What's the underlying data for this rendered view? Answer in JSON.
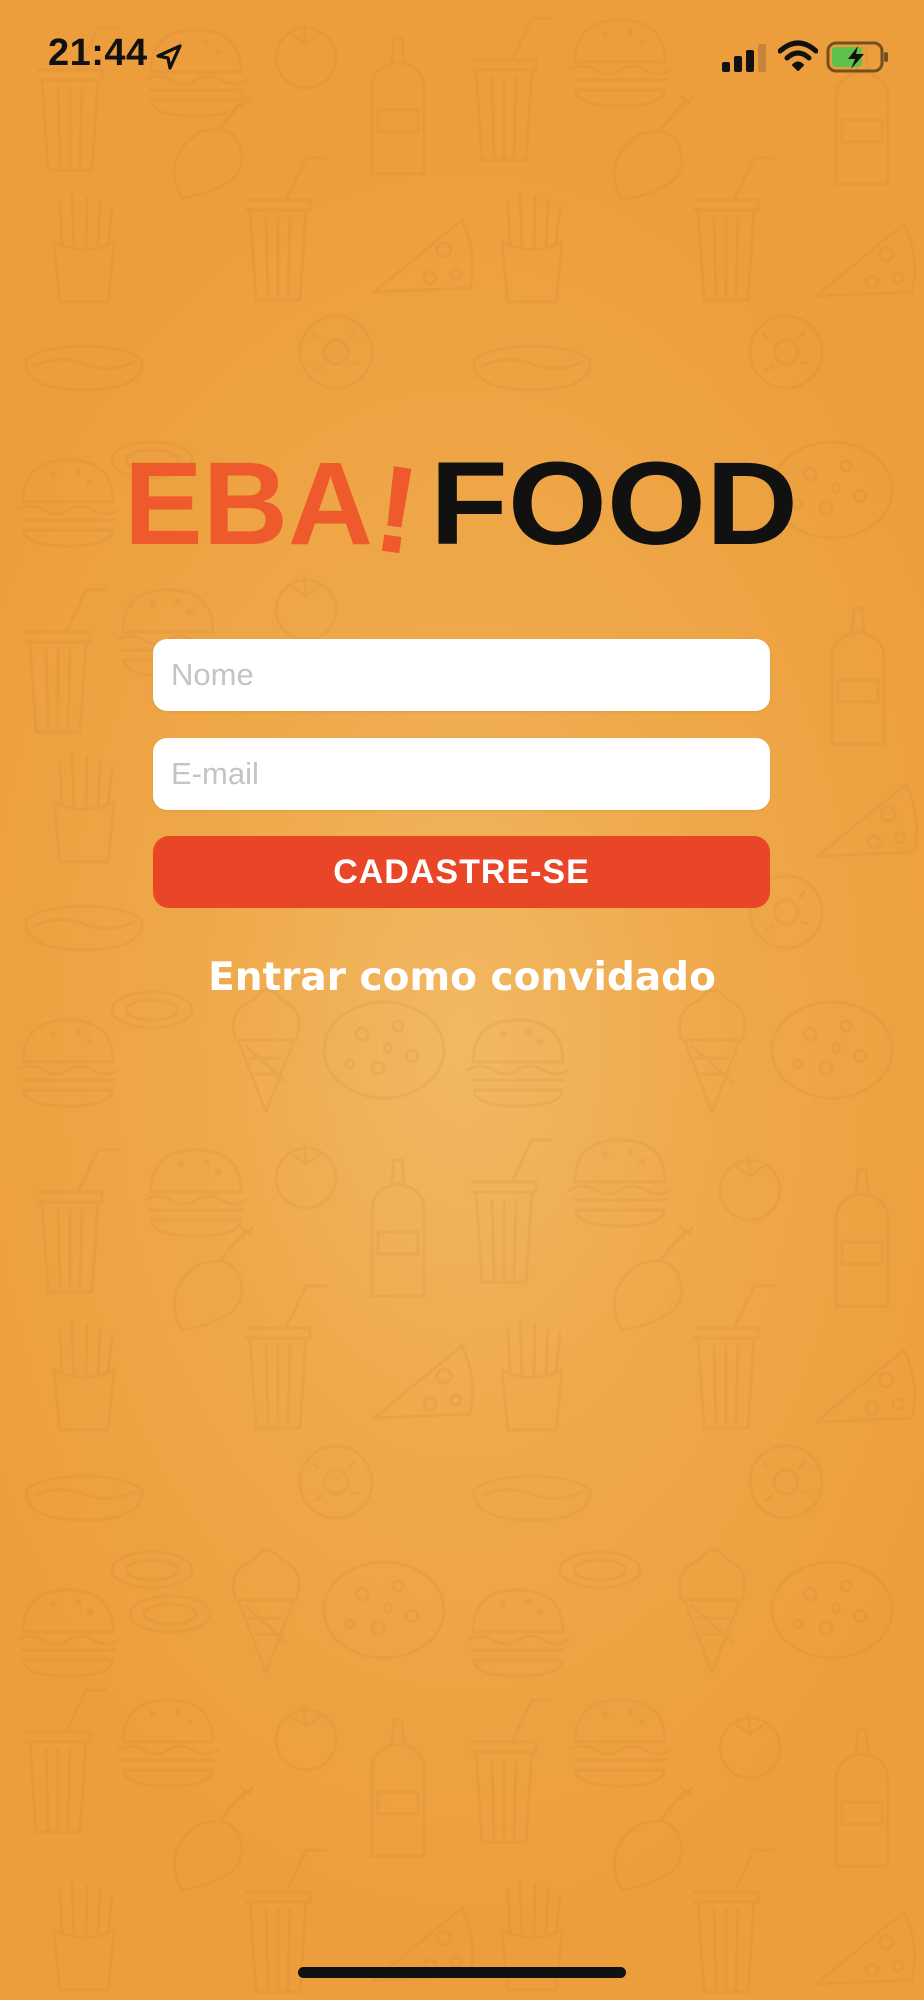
{
  "status_bar": {
    "time": "21:44",
    "location_icon": "location-arrow-icon",
    "signal_icon": "cellular-signal-icon",
    "wifi_icon": "wifi-icon",
    "battery_icon": "battery-charging-icon"
  },
  "logo": {
    "part1": "EBA",
    "exclamation": "!",
    "part2": "FOOD",
    "colors": {
      "part1": "#ef5a2d",
      "part2": "#111111"
    }
  },
  "form": {
    "name_placeholder": "Nome",
    "name_value": "",
    "email_placeholder": "E-mail",
    "email_value": "",
    "signup_label": "CADASTRE-SE",
    "guest_label": "Entrar como convidado"
  },
  "colors": {
    "background": "#efa94a",
    "button": "#e94628",
    "input_bg": "#ffffff",
    "placeholder": "#c4c4c8"
  },
  "background_pattern": {
    "icons": [
      "burger-icon",
      "fries-icon",
      "hotdog-icon",
      "donut-icon",
      "pizza-slice-icon",
      "pizza-icon",
      "cup-icon",
      "ketchup-bottle-icon",
      "tomato-icon",
      "drumstick-icon",
      "ice-cream-icon",
      "onion-ring-icon"
    ]
  }
}
